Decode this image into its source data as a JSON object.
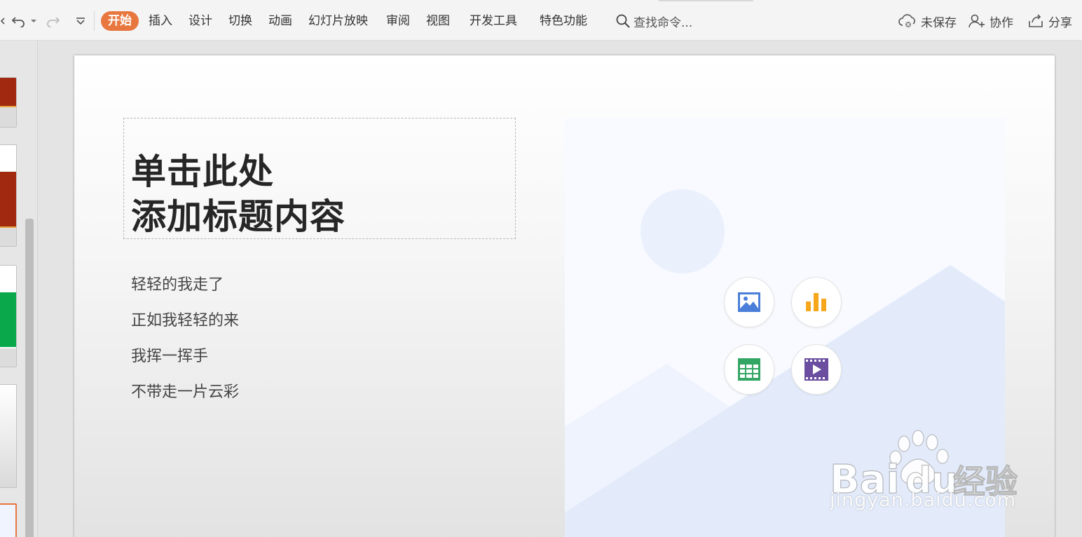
{
  "ribbon": {
    "tabs": [
      {
        "label": "开始",
        "active": true
      },
      {
        "label": "插入"
      },
      {
        "label": "设计"
      },
      {
        "label": "切换"
      },
      {
        "label": "动画"
      },
      {
        "label": "幻灯片放映"
      },
      {
        "label": "审阅"
      },
      {
        "label": "视图"
      },
      {
        "label": "开发工具"
      },
      {
        "label": "特色功能"
      }
    ],
    "search_label": "查找命令...",
    "unsaved_label": "未保存",
    "collab_label": "协作",
    "share_label": "分享",
    "accent_color": "#e8773f"
  },
  "slide": {
    "title_line1": "单击此处",
    "title_line2": "添加标题内容",
    "body_lines": [
      "轻轻的我走了",
      "正如我轻轻的来",
      "我挥一挥手",
      "不带走一片云彩"
    ],
    "placeholder_icons": [
      "picture-icon",
      "chart-icon",
      "table-icon",
      "video-icon"
    ]
  },
  "thumbnail_colors": [
    "#a0290f",
    "#a0290f",
    "#0aa84a"
  ],
  "watermark": {
    "brand": "Bai du 经验",
    "url": "jingyan.baidu.com"
  }
}
